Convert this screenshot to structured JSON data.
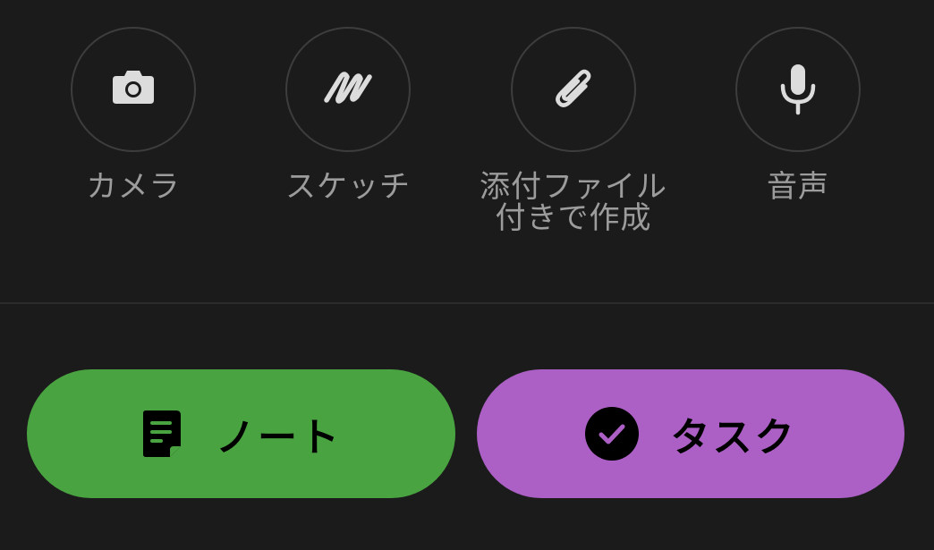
{
  "actions": [
    {
      "label": "カメラ",
      "icon": "camera-icon"
    },
    {
      "label": "スケッチ",
      "icon": "sketch-icon"
    },
    {
      "label": "添付ファイル\n付きで作成",
      "icon": "paperclip-icon"
    },
    {
      "label": "音声",
      "icon": "microphone-icon"
    }
  ],
  "buttons": {
    "note_label": "ノート",
    "task_label": "タスク"
  },
  "colors": {
    "background": "#1b1b1b",
    "circle_border": "#3d3d3d",
    "icon": "#dcdcdc",
    "label": "#9c9c9c",
    "note": "#4aa341",
    "task": "#ac60c5"
  }
}
